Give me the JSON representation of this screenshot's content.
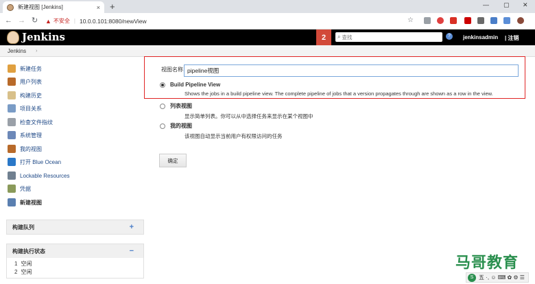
{
  "browser": {
    "tab_title": "新建视图 [Jenkins]",
    "tab_close": "×",
    "new_tab": "+",
    "window_controls": [
      "—",
      "▢",
      "✕"
    ],
    "url_security": "不安全",
    "url_separator": "|",
    "url": "10.0.0.101:8080/newView",
    "back_icon": "←",
    "forward_icon": "→",
    "reload_icon": "↻",
    "star_icon": "☆"
  },
  "header": {
    "title": "Jenkins",
    "notification_count": "2",
    "search_placeholder": "查找",
    "search_icon": "⌕",
    "help_icon": "?",
    "user": "jenkinsadmin",
    "logout": "| 注销"
  },
  "breadcrumb": {
    "items": [
      "Jenkins"
    ],
    "arrow": "›"
  },
  "sidebar": {
    "items": [
      {
        "label": "新建任务",
        "icon": "new-job-icon",
        "color": "#e0a040"
      },
      {
        "label": "用户列表",
        "icon": "users-icon",
        "color": "#b86a2a"
      },
      {
        "label": "构建历史",
        "icon": "build-history-icon",
        "color": "#d8c08a"
      },
      {
        "label": "项目关系",
        "icon": "search-icon",
        "color": "#7a9cc6"
      },
      {
        "label": "检查文件指纹",
        "icon": "fingerprint-icon",
        "color": "#9aa0a8"
      },
      {
        "label": "系统管理",
        "icon": "gear-icon",
        "color": "#6c88b8"
      },
      {
        "label": "我的视图",
        "icon": "user-icon",
        "color": "#b86a2a"
      },
      {
        "label": "打开 Blue Ocean",
        "icon": "blue-ocean-icon",
        "color": "#2a78c8"
      },
      {
        "label": "Lockable Resources",
        "icon": "lock-icon",
        "color": "#708090"
      },
      {
        "label": "凭据",
        "icon": "credentials-icon",
        "color": "#8a9a5a"
      },
      {
        "label": "新建视图",
        "icon": "folder-icon",
        "color": "#5a7fb0"
      }
    ]
  },
  "build_queue": {
    "title": "构建队列",
    "button": "+"
  },
  "executor_status": {
    "title": "构建执行状态",
    "button": "−",
    "executors": [
      {
        "num": "1",
        "status": "空闲"
      },
      {
        "num": "2",
        "status": "空闲"
      }
    ]
  },
  "form": {
    "name_label": "视图名称",
    "name_value": "pipeline视图",
    "options": [
      {
        "title": "Build Pipeline View",
        "desc": "Shows the jobs in a build pipeline view. The complete pipeline of jobs that a version propagates through are shown as a row in the view.",
        "selected": true
      },
      {
        "title": "列表视图",
        "desc": "显示简单列表。你可以从中选择任务来显示在某个视图中",
        "selected": false
      },
      {
        "title": "我的视图",
        "desc": "该视图自动显示当前用户有权限访问的任务",
        "selected": false
      }
    ],
    "ok_label": "确定"
  },
  "watermark": {
    "text": "马哥教育",
    "bar_text": "五 ·, ☺ ⌨ ✿ ⚙ ☰"
  }
}
